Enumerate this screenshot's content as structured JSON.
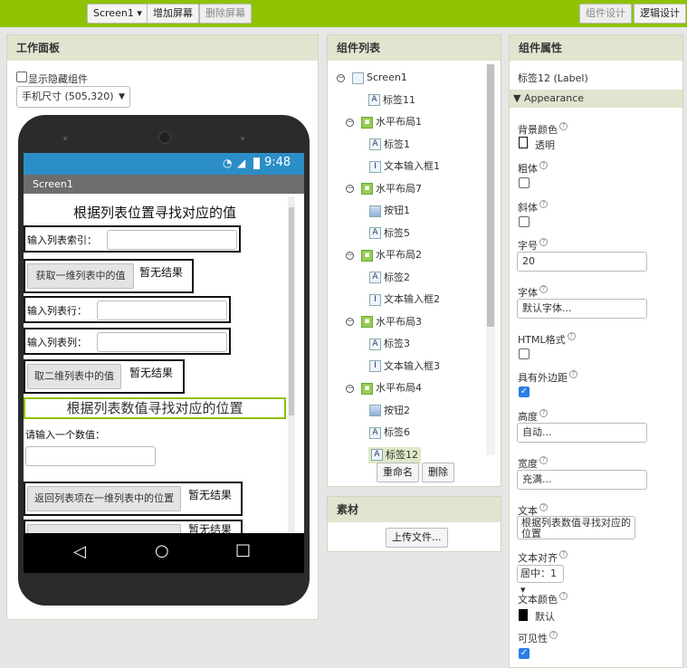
{
  "toolbar": {
    "screen_select": "Screen1 ▾",
    "add_screen": "增加屏幕",
    "remove_screen": "删除屏幕",
    "designer": "组件设计",
    "blocks": "逻辑设计"
  },
  "viewer": {
    "title": "工作面板",
    "show_hidden": "显示隐藏组件",
    "size_select": "手机尺寸 (505,320)",
    "time": "9:48",
    "screen_title": "Screen1",
    "heading1": "根据列表位置寻找对应的值",
    "label_index": "输入列表索引：",
    "btn_get1d": "获取一维列表中的值",
    "result1": "暂无结果",
    "label_row": "输入列表行：",
    "label_col": "输入列表列：",
    "btn_get2d": "取二维列表中的值",
    "result2": "暂无结果",
    "heading2": "根据列表数值寻找对应的位置",
    "label_enter": "请输入一个数值：",
    "btn_return": "返回列表项在一维列表中的位置",
    "result3": "暂无结果",
    "result4": "暂无结果",
    "nav_back": "◁",
    "nav_home": "○",
    "nav_recent": "□"
  },
  "components": {
    "title": "组件列表",
    "items": [
      "Screen1",
      "标签11",
      "水平布局1",
      "标签1",
      "文本输入框1",
      "水平布局7",
      "按钮1",
      "标签5",
      "水平布局2",
      "标签2",
      "文本输入框2",
      "水平布局3",
      "标签3",
      "文本输入框3",
      "水平布局4",
      "按钮2",
      "标签6",
      "标签12"
    ],
    "rename": "重命名",
    "delete": "删除"
  },
  "media": {
    "title": "素材",
    "upload": "上传文件..."
  },
  "properties": {
    "title": "组件属性",
    "component": "标签12 (Label)",
    "section": "Appearance",
    "bg_color": "背景颜色",
    "bg_value": "透明",
    "bold": "粗体",
    "italic": "斜体",
    "font_size": "字号",
    "font_size_value": "20",
    "font_face": "字体",
    "font_face_value": "默认字体...",
    "html_format": "HTML格式",
    "has_margins": "具有外边距",
    "height": "高度",
    "height_value": "自动...",
    "width": "宽度",
    "width_value": "充满...",
    "text": "文本",
    "text_value": "根据列表数值寻找对应的位置",
    "text_align": "文本对齐",
    "text_align_value": "居中：1 ▾",
    "text_color": "文本颜色",
    "text_color_value": "默认",
    "visible": "可见性"
  }
}
